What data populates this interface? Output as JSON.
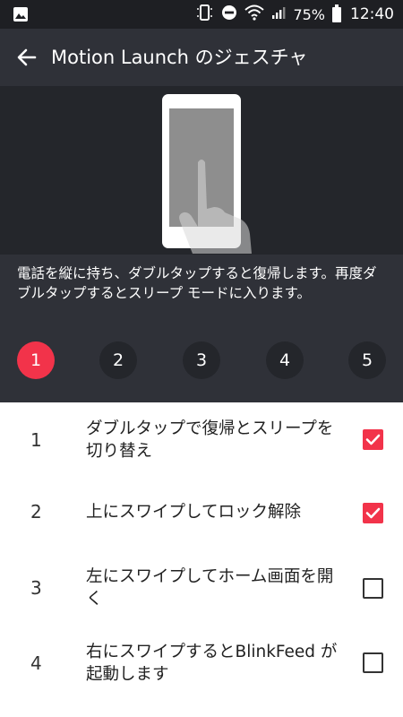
{
  "status_bar": {
    "battery_percent": "75%",
    "time": "12:40",
    "icons": [
      "image-icon",
      "phone-vibrate-icon",
      "do-not-disturb-icon",
      "wifi-icon",
      "signal-icon",
      "battery-icon"
    ]
  },
  "app_bar": {
    "title": "Motion Launch のジェスチャ",
    "back_icon": "arrow-left-icon"
  },
  "description": "電話を縦に持ち、ダブルタップすると復帰します。再度ダブルタップするとスリープ モードに入ります。",
  "steps": [
    {
      "label": "1",
      "active": true
    },
    {
      "label": "2",
      "active": false
    },
    {
      "label": "3",
      "active": false
    },
    {
      "label": "4",
      "active": false
    },
    {
      "label": "5",
      "active": false
    }
  ],
  "gestures": [
    {
      "number": "1",
      "label": "ダブルタップで復帰とスリープを切り替え",
      "checked": true
    },
    {
      "number": "2",
      "label": "上にスワイプしてロック解除",
      "checked": true
    },
    {
      "number": "3",
      "label": "左にスワイプしてホーム画面を開く",
      "checked": false
    },
    {
      "number": "4",
      "label": "右にスワイプするとBlinkFeed が起動します",
      "checked": false
    }
  ],
  "colors": {
    "accent": "#f2334a",
    "app_bar": "#2f3138",
    "status_bar": "#1e1f23",
    "illustration_bg": "#24262b"
  }
}
